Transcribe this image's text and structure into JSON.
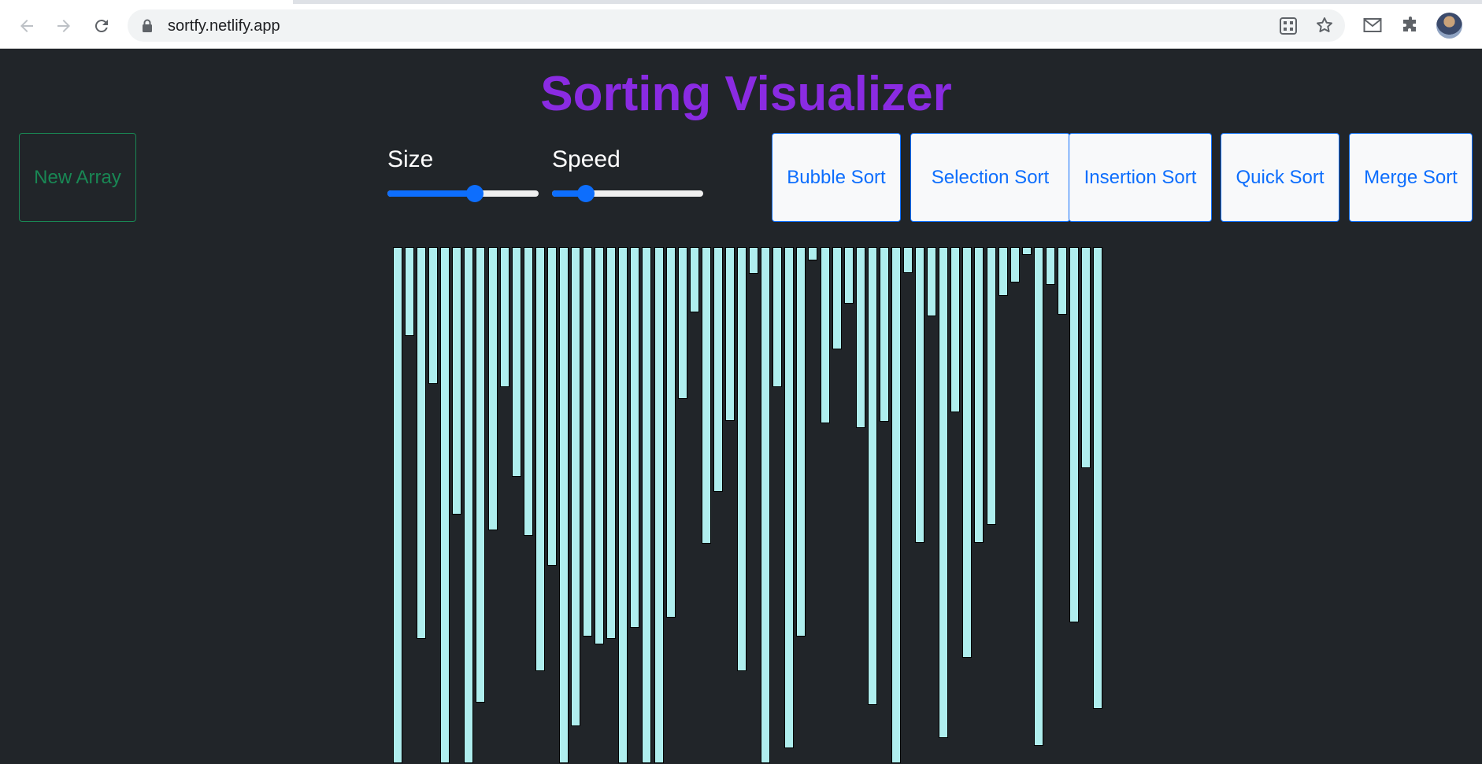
{
  "browser": {
    "url": "sortfy.netlify.app",
    "icons": [
      "back-icon",
      "forward-icon",
      "reload-icon",
      "lock-icon",
      "qr-code-icon",
      "star-icon",
      "mail-icon",
      "extensions-icon"
    ]
  },
  "page": {
    "title": "Sorting Visualizer",
    "new_array_label": "New Array",
    "size_label": "Size",
    "speed_label": "Speed",
    "size_value": 0.59,
    "speed_value": 0.19,
    "sort_buttons": [
      "Bubble Sort",
      "Selection Sort",
      "Insertion Sort",
      "Quick Sort",
      "Merge Sort"
    ]
  },
  "array": {
    "visible_count": 60,
    "values": [
      656,
      113,
      498,
      174,
      656,
      340,
      656,
      579,
      360,
      178,
      292,
      367,
      539,
      405,
      656,
      609,
      495,
      505,
      498,
      656,
      484,
      656,
      656,
      471,
      193,
      83,
      377,
      311,
      221,
      539,
      34,
      656,
      178,
      637,
      495,
      17,
      224,
      130,
      72,
      230,
      582,
      222,
      656,
      33,
      376,
      88,
      624,
      210,
      522,
      376,
      353,
      62,
      45,
      10,
      634,
      48,
      86,
      477,
      281,
      587
    ],
    "colors": {
      "bar": "#afeeee",
      "bar_border": "#000000"
    }
  },
  "colors": {
    "background": "#212529",
    "title": "#8a2be2",
    "new_array": "#198754",
    "sort_button": "#0d6efd",
    "slider": "#0d6efd"
  }
}
